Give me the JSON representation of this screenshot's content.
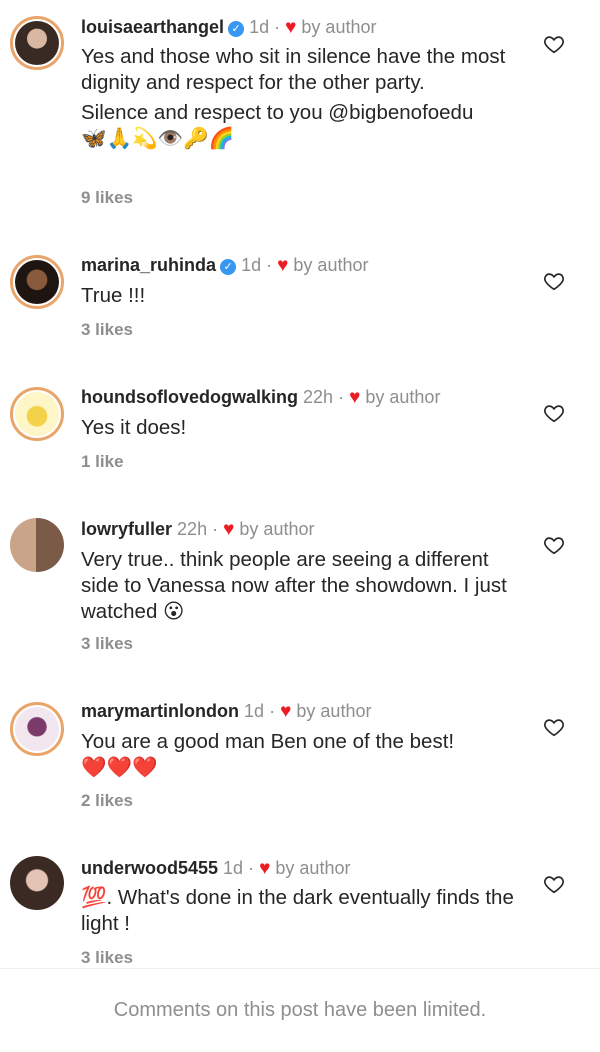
{
  "comments": [
    {
      "username": "louisaearthangel",
      "verified": true,
      "time": "1d",
      "liked_by": "by author",
      "text": [
        "Yes and those who sit in silence have the most dignity and respect for the other party.",
        "Silence and respect to you @bigbenofoedu"
      ],
      "emojis": "🦋🙏💫👁️🔑🌈",
      "likes": "9 likes"
    },
    {
      "username": "marina_ruhinda",
      "verified": true,
      "time": "1d",
      "liked_by": "by author",
      "text": [
        "True !!!"
      ],
      "likes": "3 likes"
    },
    {
      "username": "houndsoflovedogwalking",
      "verified": false,
      "time": "22h",
      "liked_by": "by author",
      "text": [
        "Yes it does!"
      ],
      "likes": "1 like"
    },
    {
      "username": "lowryfuller",
      "verified": false,
      "time": "22h",
      "liked_by": "by author",
      "text": [
        "Very true.. think people are seeing a different side to Vanessa now after the showdown. I just watched 😮"
      ],
      "likes": "3 likes"
    },
    {
      "username": "marymartinlondon",
      "verified": false,
      "time": "1d",
      "liked_by": "by author",
      "text": [
        "You are a good man Ben one of the best!"
      ],
      "emojis": "❤️❤️❤️",
      "likes": "2 likes"
    },
    {
      "username": "underwood5455",
      "verified": false,
      "time": "1d",
      "liked_by": "by author",
      "text": [
        "💯. What's done in the dark eventually finds the light !"
      ],
      "likes": "3 likes"
    }
  ],
  "footer": {
    "notice": "Comments on this post have been limited."
  },
  "colors": {
    "text": "#262626",
    "muted": "#8e8e8e",
    "heart": "#ed1c24",
    "verified": "#3897f0",
    "story_ring": "#e9a46a"
  },
  "icons": {
    "like": "heart-outline-icon",
    "liked_by_author": "heart-filled-icon",
    "verified": "verified-badge-icon"
  }
}
